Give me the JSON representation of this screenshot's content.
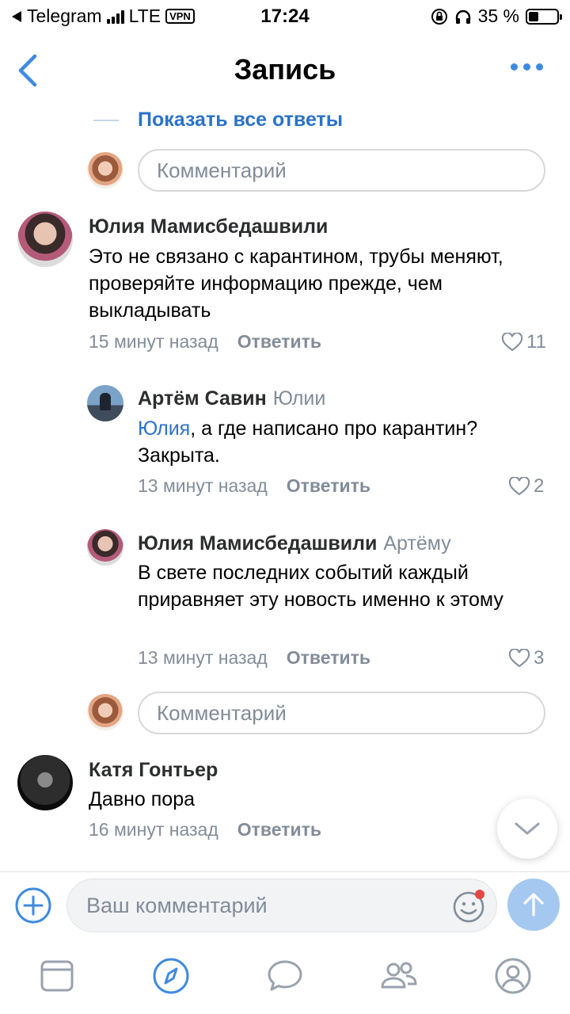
{
  "status_bar": {
    "back_app": "Telegram",
    "network": "LTE",
    "vpn": "VPN",
    "time": "17:24",
    "battery_percent": "35 %",
    "battery_level": 0.35
  },
  "nav": {
    "title": "Запись"
  },
  "thread": {
    "show_all_replies": "Показать все ответы",
    "comment_placeholder": "Комментарий"
  },
  "comments": [
    {
      "author": "Юлия Мамисбедашвили",
      "text": "Это не связано с карантином, трубы меняют, проверяйте информацию прежде, чем выкладывать",
      "time": "15 минут назад",
      "reply_label": "Ответить",
      "likes": "11"
    },
    {
      "author": "Артём Савин",
      "reply_to": "Юлии",
      "mention": "Юлия",
      "text": ", а где написано про карантин? Закрыта.",
      "time": "13 минут назад",
      "reply_label": "Ответить",
      "likes": "2"
    },
    {
      "author": "Юлия Мамисбедашвили",
      "reply_to": "Артёму",
      "text": "В свете последних событий каждый приравняет эту новость именно к этому",
      "time": "13 минут назад",
      "reply_label": "Ответить",
      "likes": "3"
    },
    {
      "author": "Катя Гонтьер",
      "text": "Давно пора",
      "time": "16 минут назад",
      "reply_label": "Ответить"
    }
  ],
  "compose": {
    "placeholder": "Ваш комментарий"
  },
  "colors": {
    "accent": "#3f8ae0",
    "link": "#2a72c9",
    "secondary_text": "#818c99",
    "send_button": "#a5c8f0",
    "notification_dot": "#e64646"
  },
  "tabs": [
    "news-icon",
    "discover-icon",
    "messages-icon",
    "friends-icon",
    "profile-icon"
  ]
}
